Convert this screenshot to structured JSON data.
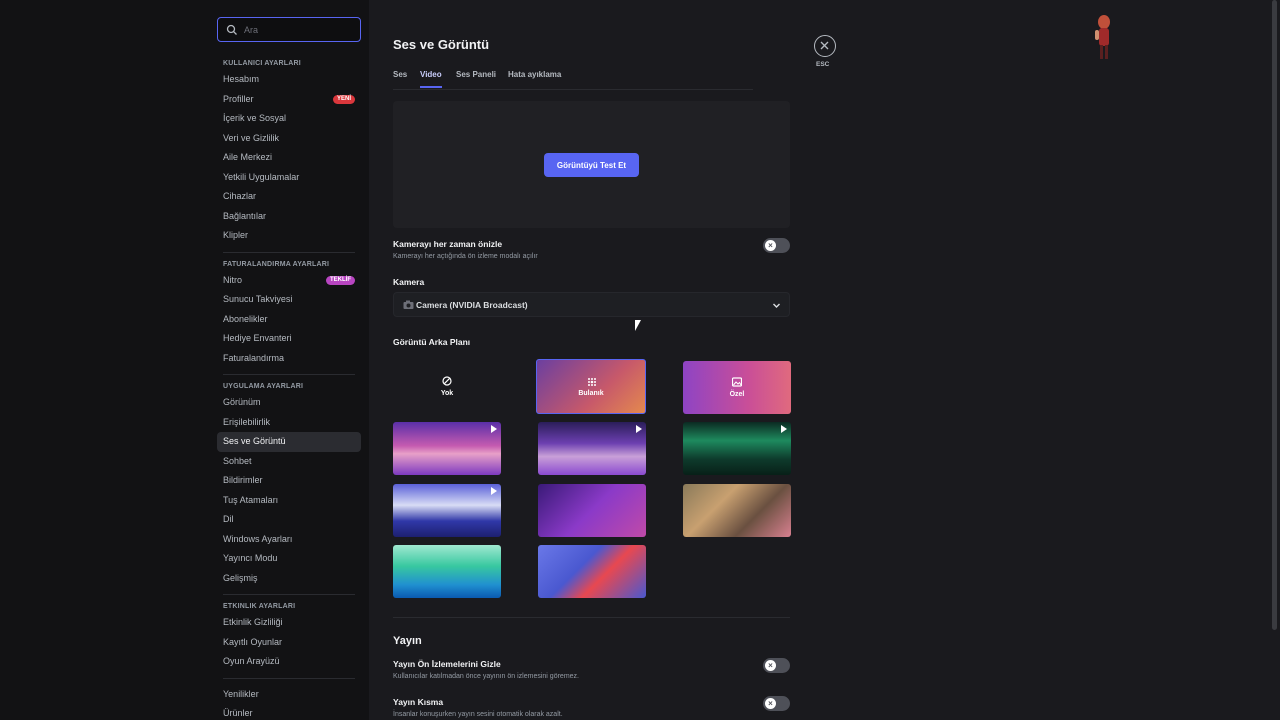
{
  "search": {
    "placeholder": "Ara"
  },
  "sidebar": {
    "sections": [
      {
        "header": "Kullanıcı Ayarları",
        "items": [
          {
            "label": "Hesabım"
          },
          {
            "label": "Profiller",
            "badge": "YENİ",
            "badge_color": "#da373c"
          },
          {
            "label": "İçerik ve Sosyal"
          },
          {
            "label": "Veri ve Gizlilik"
          },
          {
            "label": "Aile Merkezi"
          },
          {
            "label": "Yetkili Uygulamalar"
          },
          {
            "label": "Cihazlar"
          },
          {
            "label": "Bağlantılar"
          },
          {
            "label": "Klipler"
          }
        ]
      },
      {
        "header": "Faturalandırma Ayarları",
        "items": [
          {
            "label": "Nitro",
            "badge": "TEKLİF",
            "badge_color": "#b845c1"
          },
          {
            "label": "Sunucu Takviyesi"
          },
          {
            "label": "Abonelikler"
          },
          {
            "label": "Hediye Envanteri"
          },
          {
            "label": "Faturalandırma"
          }
        ]
      },
      {
        "header": "Uygulama Ayarları",
        "items": [
          {
            "label": "Görünüm"
          },
          {
            "label": "Erişilebilirlik"
          },
          {
            "label": "Ses ve Görüntü",
            "active": true
          },
          {
            "label": "Sohbet"
          },
          {
            "label": "Bildirimler"
          },
          {
            "label": "Tuş Atamaları"
          },
          {
            "label": "Dil"
          },
          {
            "label": "Windows Ayarları"
          },
          {
            "label": "Yayıncı Modu"
          },
          {
            "label": "Gelişmiş"
          }
        ]
      },
      {
        "header": "Etkinlik Ayarları",
        "items": [
          {
            "label": "Etkinlik Gizliliği"
          },
          {
            "label": "Kayıtlı Oyunlar"
          },
          {
            "label": "Oyun Arayüzü"
          }
        ]
      },
      {
        "header": "",
        "items": [
          {
            "label": "Yenilikler"
          },
          {
            "label": "Ürünler"
          }
        ]
      }
    ]
  },
  "main": {
    "title": "Ses ve Görüntü",
    "tabs": [
      "Ses",
      "Video",
      "Ses Paneli",
      "Hata ayıklama"
    ],
    "active_tab": "Video",
    "test_button": "Görüntüyü Test Et",
    "camera_preview": {
      "title": "Kamerayı her zaman önizle",
      "desc": "Kamerayı her açtığında ön izleme modalı açılır",
      "enabled": false
    },
    "camera": {
      "label": "Kamera",
      "value": "Camera (NVIDIA Broadcast)"
    },
    "background": {
      "label": "Görüntü Arka Planı",
      "options": [
        "Yok",
        "Bulanık",
        "Özel"
      ],
      "selected": "Bulanık"
    },
    "stream": {
      "title": "Yayın",
      "hide_previews": {
        "title": "Yayın Ön İzlemelerini Gizle",
        "desc": "Kullanıcılar katılmadan önce yayının ön izlemesini göremez.",
        "enabled": false
      },
      "attenuation": {
        "title": "Yayın Kısma",
        "desc": "İnsanlar konuşurken yayın sesini otomatik olarak azalt.",
        "enabled": false
      }
    }
  },
  "close": {
    "label": "ESC"
  },
  "colors": {
    "accent": "#5865f2",
    "bg": "#1a1a1e",
    "sidebar": "#121214"
  },
  "icons": [
    "search-icon",
    "close-icon",
    "camera-icon",
    "chevron-down-icon",
    "block-icon",
    "blur-icon",
    "image-icon",
    "play-icon"
  ]
}
